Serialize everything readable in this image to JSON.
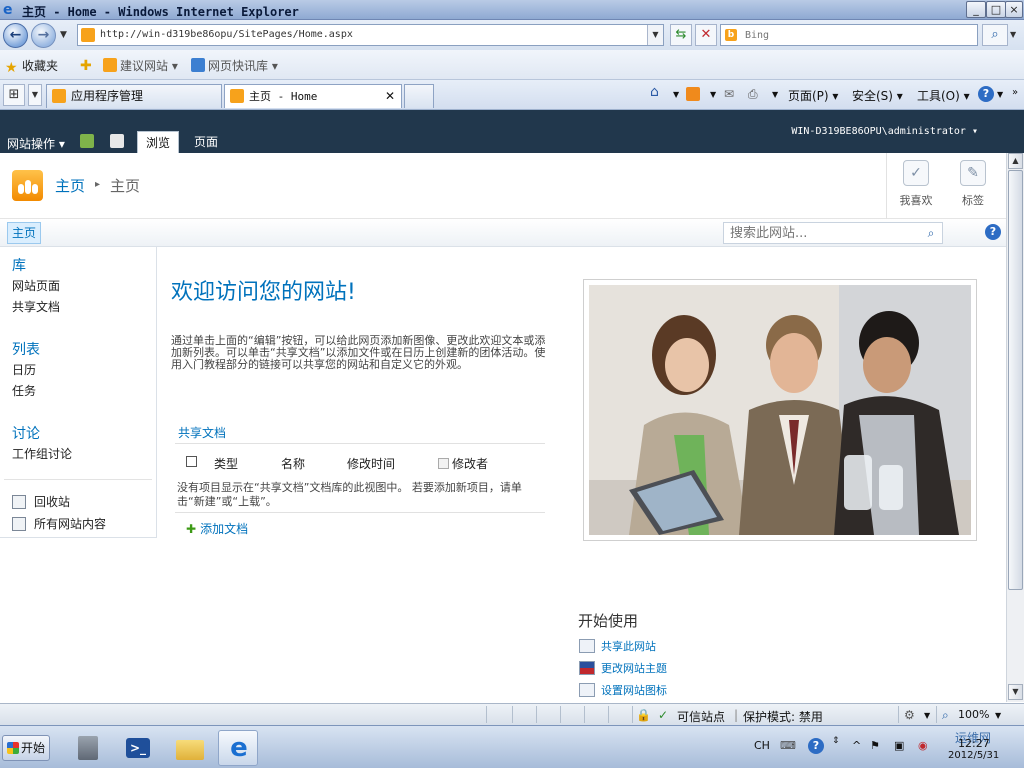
{
  "window": {
    "title": "主页 - Home - Windows Internet Explorer",
    "minimize": "_",
    "maximize": "□",
    "close": "×"
  },
  "addressbar": {
    "url": "http://win-d319be86opu/SitePages/Home.aspx",
    "search_placeholder": "Bing"
  },
  "favorites": {
    "label": "收藏夹",
    "suggested_sites": "建议网站 ▾",
    "web_slice_gallery": "网页快讯库 ▾"
  },
  "tabs": [
    {
      "label": "应用程序管理"
    },
    {
      "label": "主页 - Home",
      "active": true
    }
  ],
  "commandbar": {
    "page": "页面(P) ▾",
    "safety": "安全(S) ▾",
    "tools": "工具(O) ▾"
  },
  "ribbon": {
    "site_actions": "网站操作 ▾",
    "tabs": [
      "浏览",
      "页面"
    ],
    "user": "WIN-D319BE86OPU\\administrator ▾"
  },
  "titlearea": {
    "breadcrumb": [
      "主页",
      "主页"
    ],
    "social": [
      {
        "label": "我喜欢",
        "icon": "like-icon"
      },
      {
        "label": "标签",
        "icon": "tag-icon"
      }
    ]
  },
  "topnav": {
    "home": "主页",
    "search_placeholder": "搜索此网站..."
  },
  "leftnav": {
    "sections": [
      {
        "header": "库",
        "items": [
          "网站页面",
          "共享文档"
        ]
      },
      {
        "header": "列表",
        "items": [
          "日历",
          "任务"
        ]
      },
      {
        "header": "讨论",
        "items": [
          "工作组讨论"
        ]
      }
    ],
    "bottom": [
      "回收站",
      "所有网站内容"
    ]
  },
  "content": {
    "welcome": "欢迎访问您的网站!",
    "intro": "通过单击上面的“编辑”按钮，可以给此网页添加新图像、更改此欢迎文本或添加新列表。可以单击“共享文档”以添加文件或在日历上创建新的团体活动。使用入门教程部分的链接可以共享您的网站和自定义它的外观。",
    "library_title": "共享文档",
    "columns": [
      "类型",
      "名称",
      "修改时间",
      "修改者"
    ],
    "empty_message": "没有项目显示在“共享文档”文档库的此视图中。 若要添加新项目，请单击“新建”或“上载”。",
    "add_document": "添加文档"
  },
  "getting_started": {
    "title": "开始使用",
    "items": [
      {
        "label": "共享此网站",
        "icon": "share-site-icon"
      },
      {
        "label": "更改网站主题",
        "icon": "theme-icon"
      },
      {
        "label": "设置网站图标",
        "icon": "site-icon-icon"
      }
    ]
  },
  "statusbar": {
    "zone": "可信站点",
    "protected_mode": "保护模式: 禁用",
    "zoom": "100%"
  },
  "taskbar": {
    "start": "开始",
    "lang": "CH",
    "watermark": "运维网",
    "date": "2012/5/31",
    "time": "12:27"
  },
  "colors": {
    "sharepoint_blue": "#0072bc",
    "ribbon_bg": "#21374c",
    "accent_orange": "#f7a21b"
  }
}
